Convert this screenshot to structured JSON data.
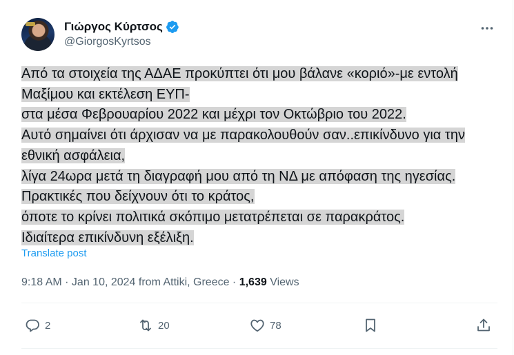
{
  "author": {
    "name": "Γιώργος Κύρτσος",
    "handle": "@GiorgosKyrtsos"
  },
  "tweet": {
    "lines": [
      "Από τα στοιχεία της ΑΔΑΕ προκύπτει ότι μου βάλανε «κοριό»-με εντολή",
      "Μαξίμου και εκτέλεση ΕΥΠ-",
      "στα μέσα Φεβρουαρίου 2022 και μέχρι τον Οκτώβριο του 2022.",
      "Αυτό σημαίνει ότι άρχισαν να με παρακολουθούν σαν..επικίνδυνο για την",
      "εθνική ασφάλεια,",
      "λίγα 24ωρα μετά τη διαγραφή μου από τη ΝΔ με απόφαση της ηγεσίας.",
      "Πρακτικές που δείχνουν ότι το κράτος,",
      "όποτε το κρίνει πολιτικά σκόπιμο μετατρέπεται σε παρακράτος.",
      "Ιδιαίτερα επικίνδυνη εξέλιξη."
    ],
    "translate_label": "Translate post",
    "timestamp": "9:18 AM · Jan 10, 2024 from Attiki, Greece · ",
    "views_count": "1,639",
    "views_label": " Views"
  },
  "actions": {
    "replies": "2",
    "reposts": "20",
    "likes": "78"
  },
  "icons": {
    "verified": "verified-badge-icon",
    "more": "more-dots-icon",
    "reply": "reply-icon",
    "repost": "repost-icon",
    "like": "heart-icon",
    "bookmark": "bookmark-icon",
    "share": "share-icon"
  },
  "colors": {
    "accent": "#1d9bf0",
    "muted": "#536471",
    "highlight": "#d5d5d5"
  }
}
